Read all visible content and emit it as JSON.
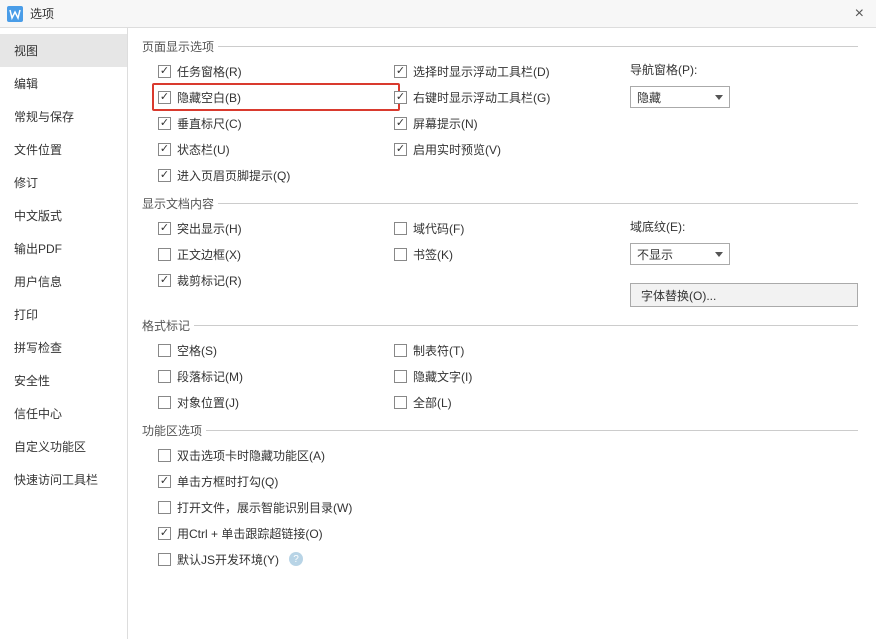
{
  "window": {
    "title": "选项",
    "close": "×"
  },
  "sidebar": {
    "items": [
      {
        "label": "视图"
      },
      {
        "label": "编辑"
      },
      {
        "label": "常规与保存"
      },
      {
        "label": "文件位置"
      },
      {
        "label": "修订"
      },
      {
        "label": "中文版式"
      },
      {
        "label": "输出PDF"
      },
      {
        "label": "用户信息"
      },
      {
        "label": "打印"
      },
      {
        "label": "拼写检查"
      },
      {
        "label": "安全性"
      },
      {
        "label": "信任中心"
      },
      {
        "label": "自定义功能区"
      },
      {
        "label": "快速访问工具栏"
      }
    ]
  },
  "groups": {
    "pageDisplay": {
      "title": "页面显示选项",
      "col1": [
        {
          "label": "任务窗格(R)",
          "checked": true
        },
        {
          "label": "隐藏空白(B)",
          "checked": true,
          "highlight": true
        },
        {
          "label": "垂直标尺(C)",
          "checked": true
        },
        {
          "label": "状态栏(U)",
          "checked": true
        },
        {
          "label": "进入页眉页脚提示(Q)",
          "checked": true
        }
      ],
      "col2": [
        {
          "label": "选择时显示浮动工具栏(D)",
          "checked": true
        },
        {
          "label": "右键时显示浮动工具栏(G)",
          "checked": true
        },
        {
          "label": "屏幕提示(N)",
          "checked": true
        },
        {
          "label": "启用实时预览(V)",
          "checked": true
        }
      ],
      "nav": {
        "label": "导航窗格(P):",
        "value": "隐藏"
      }
    },
    "docContent": {
      "title": "显示文档内容",
      "col1": [
        {
          "label": "突出显示(H)",
          "checked": true
        },
        {
          "label": "正文边框(X)",
          "checked": false
        },
        {
          "label": "裁剪标记(R)",
          "checked": true
        }
      ],
      "col2": [
        {
          "label": "域代码(F)",
          "checked": false
        },
        {
          "label": "书签(K)",
          "checked": false
        }
      ],
      "shading": {
        "label": "域底纹(E):",
        "value": "不显示"
      },
      "fontBtn": "字体替换(O)..."
    },
    "formatMarks": {
      "title": "格式标记",
      "col1": [
        {
          "label": "空格(S)",
          "checked": false
        },
        {
          "label": "段落标记(M)",
          "checked": false
        },
        {
          "label": "对象位置(J)",
          "checked": false
        }
      ],
      "col2": [
        {
          "label": "制表符(T)",
          "checked": false
        },
        {
          "label": "隐藏文字(I)",
          "checked": false
        },
        {
          "label": "全部(L)",
          "checked": false
        }
      ]
    },
    "ribbonOptions": {
      "title": "功能区选项",
      "items": [
        {
          "label": "双击选项卡时隐藏功能区(A)",
          "checked": false
        },
        {
          "label": "单击方框时打勾(Q)",
          "checked": true
        },
        {
          "label": "打开文件，展示智能识别目录(W)",
          "checked": false
        },
        {
          "label": "用Ctrl + 单击跟踪超链接(O)",
          "checked": true
        },
        {
          "label": "默认JS开发环境(Y)",
          "checked": false,
          "info": true
        }
      ]
    }
  }
}
